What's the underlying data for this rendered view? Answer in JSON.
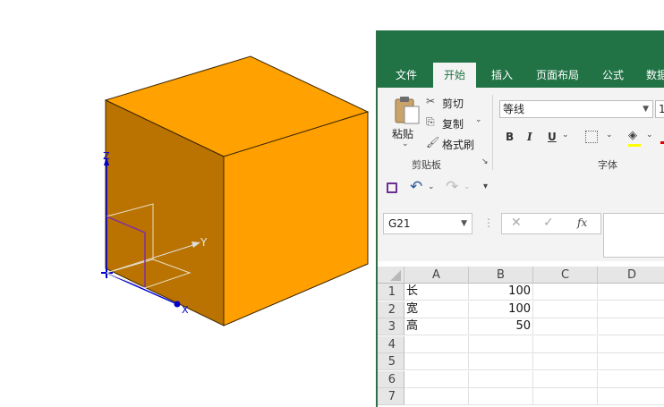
{
  "cad": {
    "cube_top_color": "#ffa100",
    "cube_front_color": "#ba7300",
    "cube_right_color": "#ff9f00",
    "axis_color": "#0000cc",
    "axes": {
      "z": "Z",
      "y": "Y",
      "x": "X"
    }
  },
  "excel": {
    "brand_color": "#217346",
    "tabs": [
      {
        "label": "文件",
        "active": false
      },
      {
        "label": "开始",
        "active": true
      },
      {
        "label": "插入",
        "active": false
      },
      {
        "label": "页面布局",
        "active": false
      },
      {
        "label": "公式",
        "active": false
      },
      {
        "label": "数据",
        "active": false
      }
    ],
    "clipboard": {
      "paste_label": "粘贴",
      "cut_label": "剪切",
      "copy_label": "复制",
      "format_painter_label": "格式刷",
      "group_label": "剪贴板"
    },
    "font": {
      "font_name": "等线",
      "font_size": "1",
      "group_label": "字体",
      "bold": "B",
      "italic": "I",
      "underline": "U"
    },
    "name_box": "G21",
    "fx_label": "fx",
    "columns": [
      "A",
      "B",
      "C",
      "D"
    ],
    "rows": [
      {
        "num": "1",
        "a": "长",
        "b": "100"
      },
      {
        "num": "2",
        "a": "宽",
        "b": "100"
      },
      {
        "num": "3",
        "a": "高",
        "b": "50"
      },
      {
        "num": "4",
        "a": "",
        "b": ""
      },
      {
        "num": "5",
        "a": "",
        "b": ""
      },
      {
        "num": "6",
        "a": "",
        "b": ""
      },
      {
        "num": "7",
        "a": "",
        "b": ""
      }
    ]
  }
}
